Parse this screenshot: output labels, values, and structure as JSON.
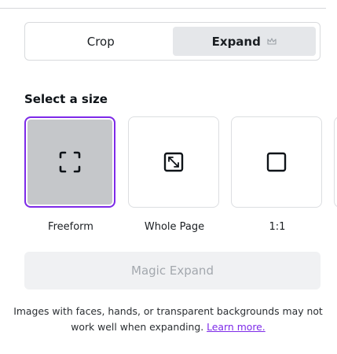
{
  "tabs": {
    "crop_label": "Crop",
    "expand_label": "Expand",
    "active": "Expand",
    "expand_badge_icon": "crown-icon"
  },
  "size_section": {
    "title": "Select a size",
    "options": [
      {
        "label": "Freeform",
        "icon": "freeform-icon",
        "selected": true
      },
      {
        "label": "Whole Page",
        "icon": "whole-page-expand-icon",
        "selected": false
      },
      {
        "label": "1:1",
        "icon": "square-icon",
        "selected": false
      }
    ]
  },
  "action": {
    "magic_expand_label": "Magic Expand",
    "disabled": true
  },
  "note": {
    "text": "Images with faces, hands, or transparent backgrounds may not work well when expanding.",
    "link_label": "Learn more."
  },
  "colors": {
    "accent": "#7d2ae8",
    "selected_tile_bg": "#c5c7ca",
    "active_tab_bg": "#e5e7ea",
    "disabled_button_bg": "#f0f1f3",
    "disabled_button_text": "#a3a8ae"
  }
}
